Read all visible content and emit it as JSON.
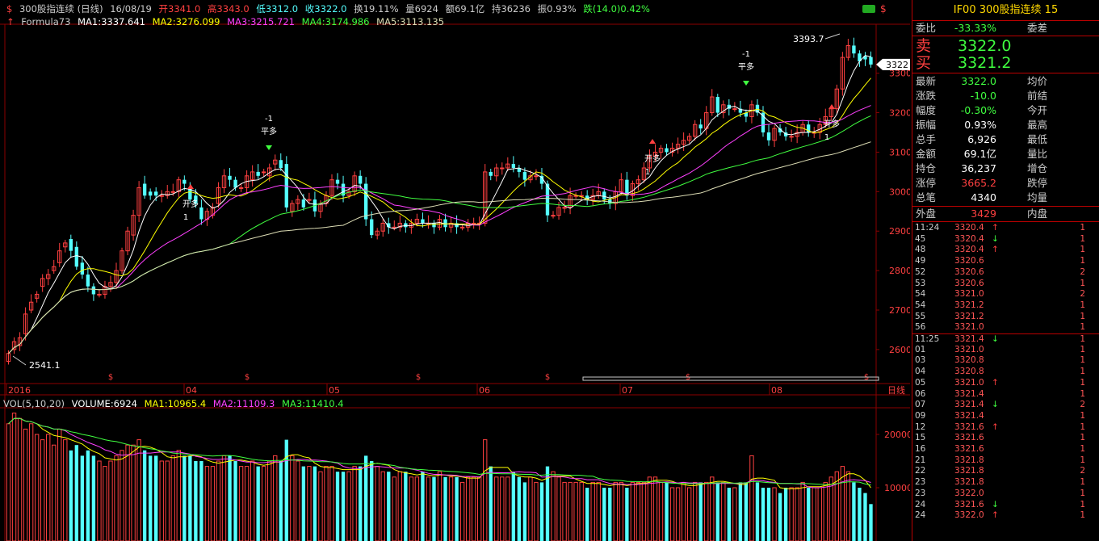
{
  "header": {
    "title": "300股指连续 (日线)",
    "date": "16/08/19",
    "open": "开3341.0",
    "high": "高3343.0",
    "low": "低3312.0",
    "close": "收3322.0",
    "turnover": "换19.11%",
    "volume": "量6924",
    "amount": "额69.1亿",
    "position": "持36236",
    "amplitude": "振0.93%",
    "change": "跌(14.0)0.42%"
  },
  "indicators": {
    "formula": "Formula73",
    "ma1": "MA1:3337.641",
    "ma2": "MA2:3276.099",
    "ma3": "MA3:3215.721",
    "ma4": "MA4:3174.986",
    "ma5": "MA5:3113.135"
  },
  "volume_header": {
    "name": "VOL(5,10,20)",
    "volume": "VOLUME:6924",
    "ma1": "MA1:10965.4",
    "ma2": "MA2:11109.3",
    "ma3": "MA3:11410.4"
  },
  "y_axis": [
    "3300",
    "3200",
    "3100",
    "3000",
    "2900",
    "2800",
    "2700",
    "2600"
  ],
  "vol_axis": [
    "20000",
    "10000"
  ],
  "x_axis": [
    "2016",
    "04",
    "05",
    "06",
    "07",
    "08"
  ],
  "period_label": "日线",
  "current_price_tag": "3322",
  "annotations": {
    "high_label": "3393.7",
    "low_label": "2541.1",
    "signals": [
      {
        "text1": "开多",
        "text2": "1"
      },
      {
        "text1": "-1",
        "text2": "平多"
      },
      {
        "text1": "开多",
        "text2": "1"
      },
      {
        "text1": "-1",
        "text2": "平多"
      },
      {
        "text1": "开多",
        "text2": "1"
      }
    ],
    "s_marker": "$"
  },
  "right_panel": {
    "title": "IF00  300股指连续  15",
    "weibi_label": "委比",
    "weibi_value": "-33.33%",
    "weicha_label": "委差",
    "sell_label": "卖",
    "sell_value": "3322.0",
    "buy_label": "买",
    "buy_value": "3321.2",
    "rows": [
      {
        "l": "最新",
        "v": "3322.0",
        "vc": "green",
        "l2": "均价",
        "v2": ""
      },
      {
        "l": "涨跌",
        "v": "-10.0",
        "vc": "green",
        "l2": "前结",
        "v2": ""
      },
      {
        "l": "幅度",
        "v": "-0.30%",
        "vc": "green",
        "l2": "今开",
        "v2": ""
      },
      {
        "l": "振幅",
        "v": "0.93%",
        "vc": "white",
        "l2": "最高",
        "v2": ""
      },
      {
        "l": "总手",
        "v": "6,926",
        "vc": "white",
        "l2": "最低",
        "v2": ""
      },
      {
        "l": "金额",
        "v": "69.1亿",
        "vc": "white",
        "l2": "量比",
        "v2": ""
      },
      {
        "l": "持仓",
        "v": "36,237",
        "vc": "white",
        "l2": "增仓",
        "v2": ""
      },
      {
        "l": "涨停",
        "v": "3665.2",
        "vc": "red",
        "l2": "跌停",
        "v2": ""
      },
      {
        "l": "总笔",
        "v": "4340",
        "vc": "white",
        "l2": "均量",
        "v2": ""
      }
    ],
    "outer_label": "外盘",
    "outer_value": "3429",
    "inner_label": "内盘",
    "ticks": [
      {
        "t": "11:24",
        "p": "3320.4",
        "a": "↑",
        "ac": "red",
        "v": "1"
      },
      {
        "t": "45",
        "p": "3320.4",
        "a": "↓",
        "ac": "green",
        "v": "1"
      },
      {
        "t": "48",
        "p": "3320.4",
        "a": "↑",
        "ac": "red",
        "v": "1"
      },
      {
        "t": "49",
        "p": "3320.6",
        "a": "",
        "ac": "red",
        "v": "1"
      },
      {
        "t": "52",
        "p": "3320.6",
        "a": "",
        "ac": "red",
        "v": "2"
      },
      {
        "t": "53",
        "p": "3320.6",
        "a": "",
        "ac": "red",
        "v": "1"
      },
      {
        "t": "54",
        "p": "3321.0",
        "a": "",
        "ac": "red",
        "v": "2"
      },
      {
        "t": "54",
        "p": "3321.2",
        "a": "",
        "ac": "red",
        "v": "1"
      },
      {
        "t": "55",
        "p": "3321.2",
        "a": "",
        "ac": "red",
        "v": "1"
      },
      {
        "t": "56",
        "p": "3321.0",
        "a": "",
        "ac": "red",
        "v": "1"
      },
      {
        "t": "11:25",
        "p": "3321.4",
        "a": "↓",
        "ac": "green",
        "v": "1"
      },
      {
        "t": "01",
        "p": "3321.0",
        "a": "",
        "ac": "red",
        "v": "1"
      },
      {
        "t": "03",
        "p": "3320.8",
        "a": "",
        "ac": "red",
        "v": "1"
      },
      {
        "t": "04",
        "p": "3320.8",
        "a": "",
        "ac": "red",
        "v": "1"
      },
      {
        "t": "05",
        "p": "3321.0",
        "a": "↑",
        "ac": "red",
        "v": "1"
      },
      {
        "t": "06",
        "p": "3321.4",
        "a": "",
        "ac": "red",
        "v": "1"
      },
      {
        "t": "07",
        "p": "3321.4",
        "a": "↓",
        "ac": "green",
        "v": "2"
      },
      {
        "t": "09",
        "p": "3321.4",
        "a": "",
        "ac": "red",
        "v": "1"
      },
      {
        "t": "12",
        "p": "3321.6",
        "a": "↑",
        "ac": "red",
        "v": "1"
      },
      {
        "t": "15",
        "p": "3321.6",
        "a": "",
        "ac": "red",
        "v": "1"
      },
      {
        "t": "16",
        "p": "3321.6",
        "a": "",
        "ac": "red",
        "v": "1"
      },
      {
        "t": "21",
        "p": "3321.8",
        "a": "",
        "ac": "red",
        "v": "1"
      },
      {
        "t": "22",
        "p": "3321.8",
        "a": "",
        "ac": "red",
        "v": "2"
      },
      {
        "t": "23",
        "p": "3321.8",
        "a": "",
        "ac": "red",
        "v": "1"
      },
      {
        "t": "23",
        "p": "3322.0",
        "a": "",
        "ac": "red",
        "v": "1"
      },
      {
        "t": "24",
        "p": "3321.6",
        "a": "↓",
        "ac": "green",
        "v": "1"
      },
      {
        "t": "24",
        "p": "3322.0",
        "a": "↑",
        "ac": "red",
        "v": "1"
      }
    ]
  },
  "colors": {
    "up": "#ff4040",
    "down": "#54ffff",
    "ma1": "#ffffff",
    "ma2": "#ffff00",
    "ma3": "#ff40ff",
    "ma4": "#40ff40",
    "ma5": "#dcdcb4",
    "grid": "#8b0000"
  },
  "chart_data": {
    "type": "candlestick",
    "price_range": [
      2520,
      3420
    ],
    "volume_range": [
      0,
      25000
    ],
    "opens": [
      2570,
      2600,
      2610,
      2640,
      2700,
      2730,
      2760,
      2780,
      2800,
      2820,
      2860,
      2880,
      2860,
      2820,
      2790,
      2760,
      2740,
      2740,
      2760,
      2770,
      2800,
      2850,
      2890,
      2940,
      3020,
      3000,
      3000,
      2990,
      2990,
      3000,
      3000,
      3030,
      3010,
      2990,
      2960,
      2930,
      2940,
      2970,
      3010,
      3040,
      3030,
      3010,
      3010,
      3030,
      3050,
      3050,
      3040,
      3070,
      3080,
      3070,
      2950,
      2970,
      2980,
      2980,
      2980,
      2950,
      2970,
      2990,
      3030,
      3020,
      2990,
      3000,
      3040,
      3020,
      2930,
      2890,
      2900,
      2920,
      2910,
      2910,
      2920,
      2910,
      2920,
      2930,
      2920,
      2920,
      2910,
      2930,
      2910,
      2920,
      2910,
      2910,
      2920,
      2920,
      2920,
      3050,
      3040,
      3060,
      3060,
      3070,
      3060,
      3050,
      3030,
      3040,
      3040,
      3020,
      2940,
      2940,
      2960,
      2960,
      2990,
      2990,
      2990,
      2980,
      2990,
      3000,
      2980,
      2970,
      3000,
      3030,
      2990,
      3020,
      3030,
      3060,
      3090,
      3100,
      3110,
      3100,
      3110,
      3120,
      3130,
      3140,
      3170,
      3160,
      3200,
      3240,
      3200,
      3220,
      3210,
      3210,
      3200,
      3190,
      3220,
      3200,
      3150,
      3130,
      3160,
      3150,
      3140,
      3140,
      3150,
      3170,
      3150,
      3150,
      3170,
      3190,
      3210,
      3260,
      3340,
      3370,
      3350,
      3343,
      3341
    ],
    "closes": [
      2590,
      2620,
      2630,
      2690,
      2720,
      2740,
      2780,
      2790,
      2810,
      2850,
      2870,
      2850,
      2810,
      2790,
      2760,
      2740,
      2740,
      2760,
      2770,
      2800,
      2850,
      2900,
      2940,
      3010,
      2990,
      2990,
      2990,
      2990,
      3000,
      3000,
      3030,
      3020,
      2980,
      2970,
      2930,
      2950,
      2960,
      3010,
      3040,
      3030,
      3010,
      3010,
      3040,
      3050,
      3040,
      3050,
      3060,
      3080,
      3060,
      2960,
      2970,
      2980,
      2960,
      2980,
      2950,
      2970,
      2990,
      3030,
      3020,
      2990,
      3000,
      3040,
      3020,
      2930,
      2890,
      2900,
      2920,
      2910,
      2910,
      2920,
      2910,
      2920,
      2930,
      2920,
      2920,
      2910,
      2930,
      2910,
      2920,
      2910,
      2910,
      2920,
      2920,
      2920,
      3050,
      3040,
      3060,
      3060,
      3070,
      3060,
      3050,
      3030,
      3040,
      3040,
      3020,
      2940,
      2940,
      2960,
      2960,
      2990,
      2990,
      2990,
      2980,
      2990,
      3000,
      2980,
      2970,
      3000,
      3030,
      2990,
      3020,
      3030,
      3060,
      3090,
      3100,
      3110,
      3100,
      3110,
      3120,
      3130,
      3140,
      3170,
      3160,
      3200,
      3240,
      3200,
      3220,
      3210,
      3210,
      3200,
      3190,
      3220,
      3200,
      3150,
      3130,
      3160,
      3150,
      3140,
      3140,
      3150,
      3170,
      3150,
      3150,
      3170,
      3190,
      3210,
      3260,
      3340,
      3370,
      3350,
      3330,
      3335,
      3322
    ],
    "volumes": [
      22000,
      24000,
      23000,
      21000,
      22000,
      20000,
      19000,
      20000,
      18000,
      21000,
      19000,
      17000,
      18000,
      16000,
      17000,
      16000,
      15000,
      14000,
      15000,
      16000,
      17000,
      18000,
      18000,
      19000,
      17000,
      16000,
      16000,
      15000,
      15000,
      16000,
      17000,
      16000,
      16000,
      15000,
      15000,
      14000,
      14000,
      15000,
      16000,
      16000,
      15000,
      14000,
      14000,
      15000,
      14000,
      14000,
      15000,
      16000,
      15000,
      19000,
      16000,
      15000,
      14000,
      14000,
      14000,
      13000,
      14000,
      14000,
      13000,
      13000,
      13000,
      14000,
      14000,
      16000,
      15000,
      14000,
      13000,
      13000,
      12000,
      13000,
      13000,
      12000,
      12000,
      13000,
      12000,
      12000,
      13000,
      12000,
      12000,
      12000,
      11000,
      12000,
      12000,
      12000,
      19000,
      14000,
      12000,
      12000,
      12000,
      13000,
      12000,
      11000,
      12000,
      11000,
      11000,
      14000,
      13000,
      12000,
      11000,
      11000,
      11000,
      11000,
      10000,
      11000,
      11000,
      10000,
      10000,
      11000,
      11000,
      10000,
      11000,
      11000,
      11000,
      12000,
      12000,
      11000,
      11000,
      10000,
      10000,
      11000,
      10000,
      11000,
      11000,
      11000,
      12000,
      11000,
      11000,
      10000,
      10000,
      11000,
      11000,
      16000,
      11000,
      10000,
      10000,
      10000,
      9000,
      10000,
      10000,
      10000,
      11000,
      10000,
      10000,
      10000,
      11000,
      12000,
      13000,
      14000,
      13000,
      11000,
      10000,
      9000,
      6924
    ]
  }
}
